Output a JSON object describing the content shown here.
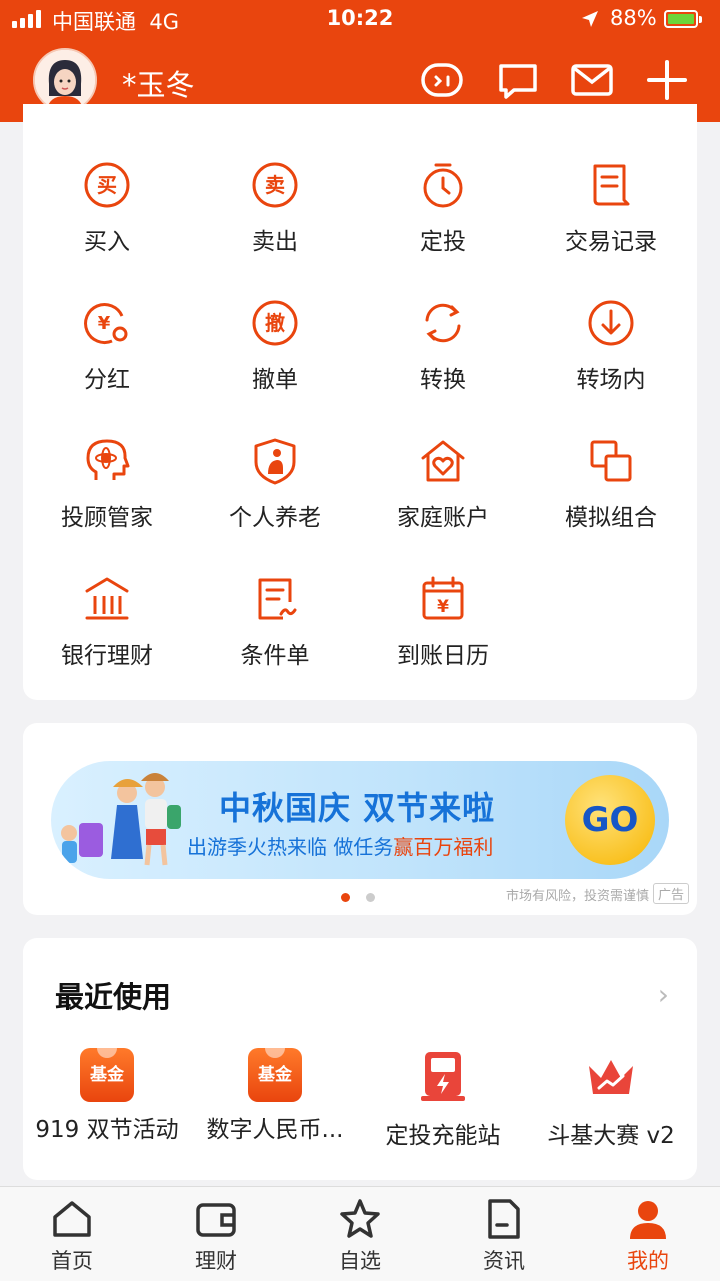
{
  "status_bar": {
    "carrier": "中国联通",
    "network": "4G",
    "time": "10:22",
    "battery": "88%"
  },
  "header": {
    "username": "*玉冬",
    "icons": [
      "robot-chat-icon",
      "message-icon",
      "mail-icon",
      "plus-icon"
    ]
  },
  "theme": {
    "accent": "#e9450e",
    "banner_blue": "#1672d8"
  },
  "grid": [
    {
      "label": "买入",
      "icon": "buy-icon"
    },
    {
      "label": "卖出",
      "icon": "sell-icon"
    },
    {
      "label": "定投",
      "icon": "timer-icon"
    },
    {
      "label": "交易记录",
      "icon": "record-icon"
    },
    {
      "label": "分红",
      "icon": "dividend-icon"
    },
    {
      "label": "撤单",
      "icon": "cancel-order-icon"
    },
    {
      "label": "转换",
      "icon": "convert-icon"
    },
    {
      "label": "转场内",
      "icon": "transfer-in-icon"
    },
    {
      "label": "投顾管家",
      "icon": "advisor-icon"
    },
    {
      "label": "个人养老",
      "icon": "pension-icon"
    },
    {
      "label": "家庭账户",
      "icon": "family-account-icon"
    },
    {
      "label": "模拟组合",
      "icon": "portfolio-icon"
    },
    {
      "label": "银行理财",
      "icon": "bank-icon"
    },
    {
      "label": "条件单",
      "icon": "condition-order-icon"
    },
    {
      "label": "到账日历",
      "icon": "calendar-icon"
    }
  ],
  "banner": {
    "title": "中秋国庆 双节来啦",
    "subtitle_a": "出游季火热来临  做任务",
    "subtitle_b": "赢百万福利",
    "button": "GO",
    "risk_note": "市场有风险，投资需谨慎",
    "ad_tag": "广告",
    "page_index": 1,
    "page_count": 2
  },
  "recent": {
    "title": "最近使用",
    "items": [
      {
        "label": "919 双节活动",
        "badge": "基金"
      },
      {
        "label": "数字人民币...",
        "badge": "基金"
      },
      {
        "label": "定投充能站",
        "icon": "charging-station-icon"
      },
      {
        "label": "斗基大赛 v2",
        "icon": "crown-icon"
      }
    ]
  },
  "tabs": [
    {
      "label": "首页",
      "icon": "home-icon"
    },
    {
      "label": "理财",
      "icon": "wallet-icon"
    },
    {
      "label": "自选",
      "icon": "star-icon"
    },
    {
      "label": "资讯",
      "icon": "news-icon"
    },
    {
      "label": "我的",
      "icon": "profile-icon",
      "active": true
    }
  ]
}
